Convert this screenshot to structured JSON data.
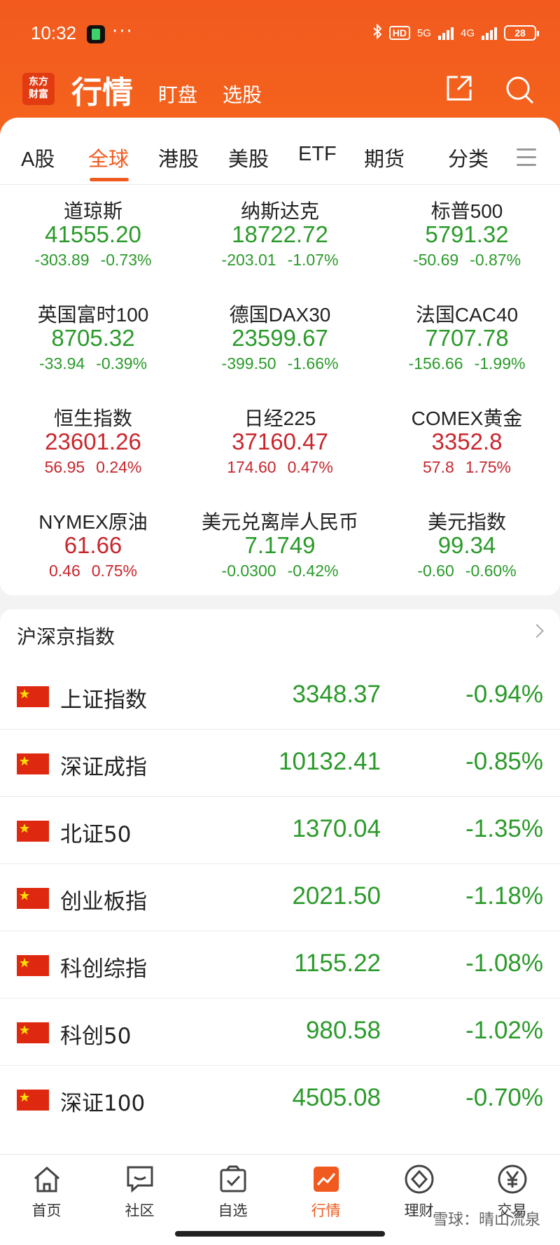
{
  "status_bar": {
    "time": "10:32",
    "hd": "HD",
    "net1": "5G",
    "net2": "4G",
    "battery": "28"
  },
  "header": {
    "logo_line1": "东方",
    "logo_line2": "财富",
    "title": "行情",
    "tab1": "盯盘",
    "tab2": "选股"
  },
  "tabs": [
    "A股",
    "全球",
    "港股",
    "美股",
    "ETF",
    "期货",
    "分类"
  ],
  "active_tab": "全球",
  "global_indices": [
    {
      "name": "道琼斯",
      "value": "41555.20",
      "change": "-303.89",
      "pct": "-0.73%",
      "dir": "down"
    },
    {
      "name": "纳斯达克",
      "value": "18722.72",
      "change": "-203.01",
      "pct": "-1.07%",
      "dir": "down"
    },
    {
      "name": "标普500",
      "value": "5791.32",
      "change": "-50.69",
      "pct": "-0.87%",
      "dir": "down"
    },
    {
      "name": "英国富时100",
      "value": "8705.32",
      "change": "-33.94",
      "pct": "-0.39%",
      "dir": "down"
    },
    {
      "name": "德国DAX30",
      "value": "23599.67",
      "change": "-399.50",
      "pct": "-1.66%",
      "dir": "down"
    },
    {
      "name": "法国CAC40",
      "value": "7707.78",
      "change": "-156.66",
      "pct": "-1.99%",
      "dir": "down"
    },
    {
      "name": "恒生指数",
      "value": "23601.26",
      "change": "56.95",
      "pct": "0.24%",
      "dir": "up"
    },
    {
      "name": "日经225",
      "value": "37160.47",
      "change": "174.60",
      "pct": "0.47%",
      "dir": "up"
    },
    {
      "name": "COMEX黄金",
      "value": "3352.8",
      "change": "57.8",
      "pct": "1.75%",
      "dir": "up"
    },
    {
      "name": "NYMEX原油",
      "value": "61.66",
      "change": "0.46",
      "pct": "0.75%",
      "dir": "up"
    },
    {
      "name": "美元兑离岸人民币",
      "value": "7.1749",
      "change": "-0.0300",
      "pct": "-0.42%",
      "dir": "down"
    },
    {
      "name": "美元指数",
      "value": "99.34",
      "change": "-0.60",
      "pct": "-0.60%",
      "dir": "down"
    }
  ],
  "section": {
    "title": "沪深京指数"
  },
  "domestic_indices": [
    {
      "name": "上证指数",
      "price": "3348.37",
      "pct": "-0.94%"
    },
    {
      "name": "深证成指",
      "price": "10132.41",
      "pct": "-0.85%"
    },
    {
      "name": "北证50",
      "price": "1370.04",
      "pct": "-1.35%"
    },
    {
      "name": "创业板指",
      "price": "2021.50",
      "pct": "-1.18%"
    },
    {
      "name": "科创综指",
      "price": "1155.22",
      "pct": "-1.08%"
    },
    {
      "name": "科创50",
      "price": "980.58",
      "pct": "-1.02%"
    },
    {
      "name": "深证100",
      "price": "4505.08",
      "pct": "-0.70%"
    }
  ],
  "bottom_nav": [
    {
      "label": "首页",
      "icon": "home-icon"
    },
    {
      "label": "社区",
      "icon": "chat-icon"
    },
    {
      "label": "自选",
      "icon": "watchlist-icon"
    },
    {
      "label": "行情",
      "icon": "market-chart-icon"
    },
    {
      "label": "理财",
      "icon": "diamond-icon"
    },
    {
      "label": "交易",
      "icon": "yen-icon"
    }
  ],
  "watermark": "雪球：晴山流泉",
  "colors": {
    "brand": "#f25a1e",
    "up": "#c8262d",
    "down": "#2a9a2a"
  }
}
